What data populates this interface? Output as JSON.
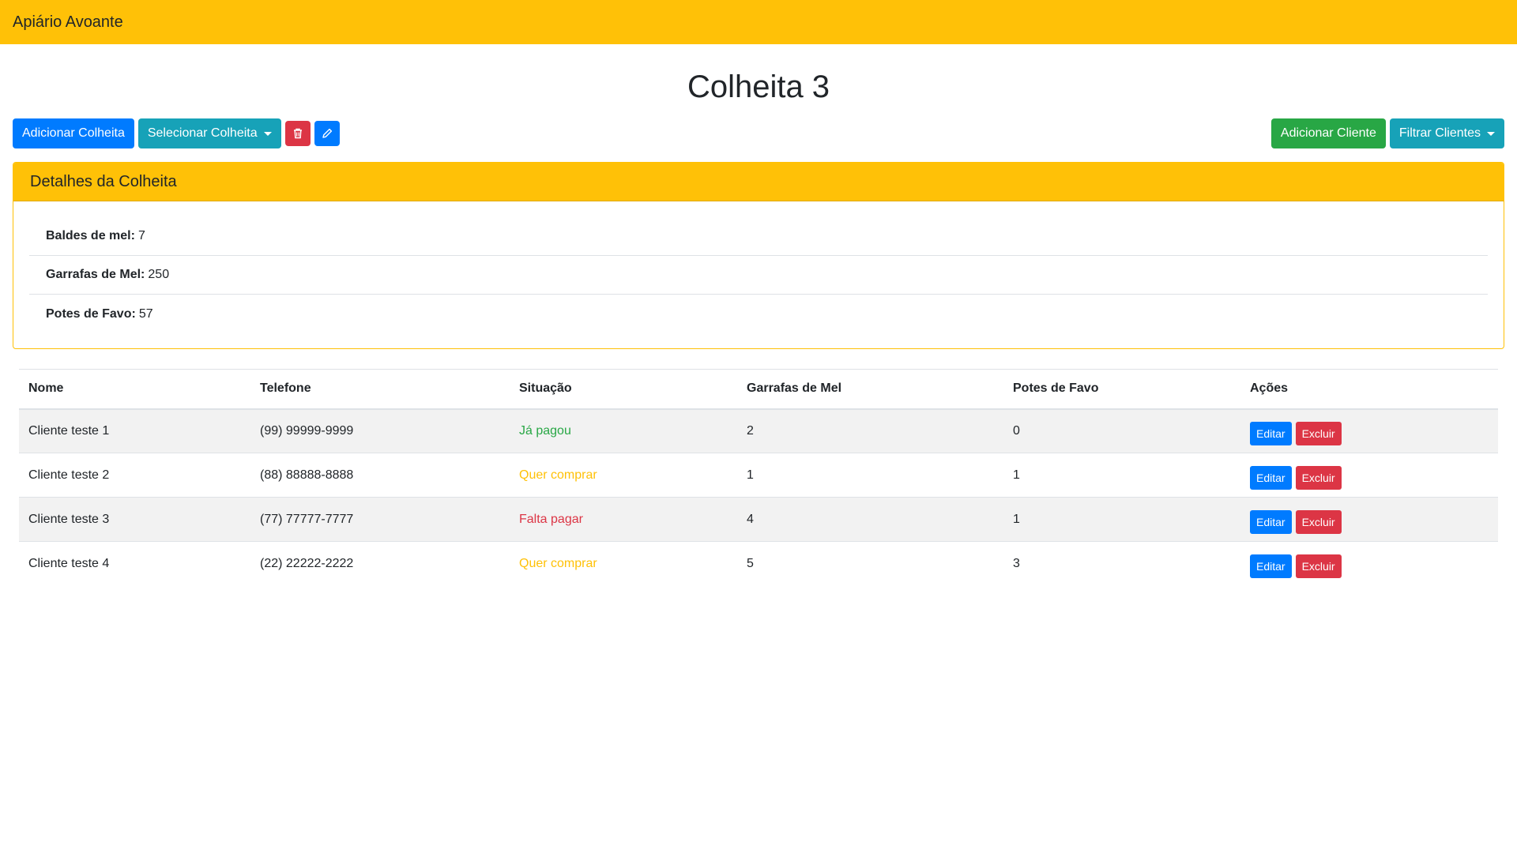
{
  "navbar": {
    "brand": "Apiário Avoante"
  },
  "page": {
    "title": "Colheita 3"
  },
  "toolbar": {
    "add_harvest": "Adicionar Colheita",
    "select_harvest": "Selecionar Colheita",
    "add_client": "Adicionar Cliente",
    "filter_clients": "Filtrar Clientes"
  },
  "details": {
    "header": "Detalhes da Colheita",
    "rows": [
      {
        "label": "Baldes de mel:",
        "value": "7"
      },
      {
        "label": "Garrafas de Mel:",
        "value": "250"
      },
      {
        "label": "Potes de Favo:",
        "value": "57"
      }
    ]
  },
  "table": {
    "headers": [
      "Nome",
      "Telefone",
      "Situação",
      "Garrafas de Mel",
      "Potes de Favo",
      "Ações"
    ],
    "rows": [
      {
        "nome": "Cliente teste 1",
        "telefone": "(99) 99999-9999",
        "situacao": "Já pagou",
        "garrafas": "2",
        "potes": "0"
      },
      {
        "nome": "Cliente teste 2",
        "telefone": "(88) 88888-8888",
        "situacao": "Quer comprar",
        "garrafas": "1",
        "potes": "1"
      },
      {
        "nome": "Cliente teste 3",
        "telefone": "(77) 77777-7777",
        "situacao": "Falta pagar",
        "garrafas": "4",
        "potes": "1"
      },
      {
        "nome": "Cliente teste 4",
        "telefone": "(22) 22222-2222",
        "situacao": "Quer comprar",
        "garrafas": "5",
        "potes": "3"
      }
    ],
    "edit_label": "Editar",
    "delete_label": "Excluir"
  },
  "colors": {
    "warning": "#ffc107",
    "primary": "#007bff",
    "info": "#17a2b8",
    "success": "#28a745",
    "danger": "#dc3545"
  },
  "icons": {
    "delete": "trash-icon",
    "edit": "pencil-icon"
  }
}
